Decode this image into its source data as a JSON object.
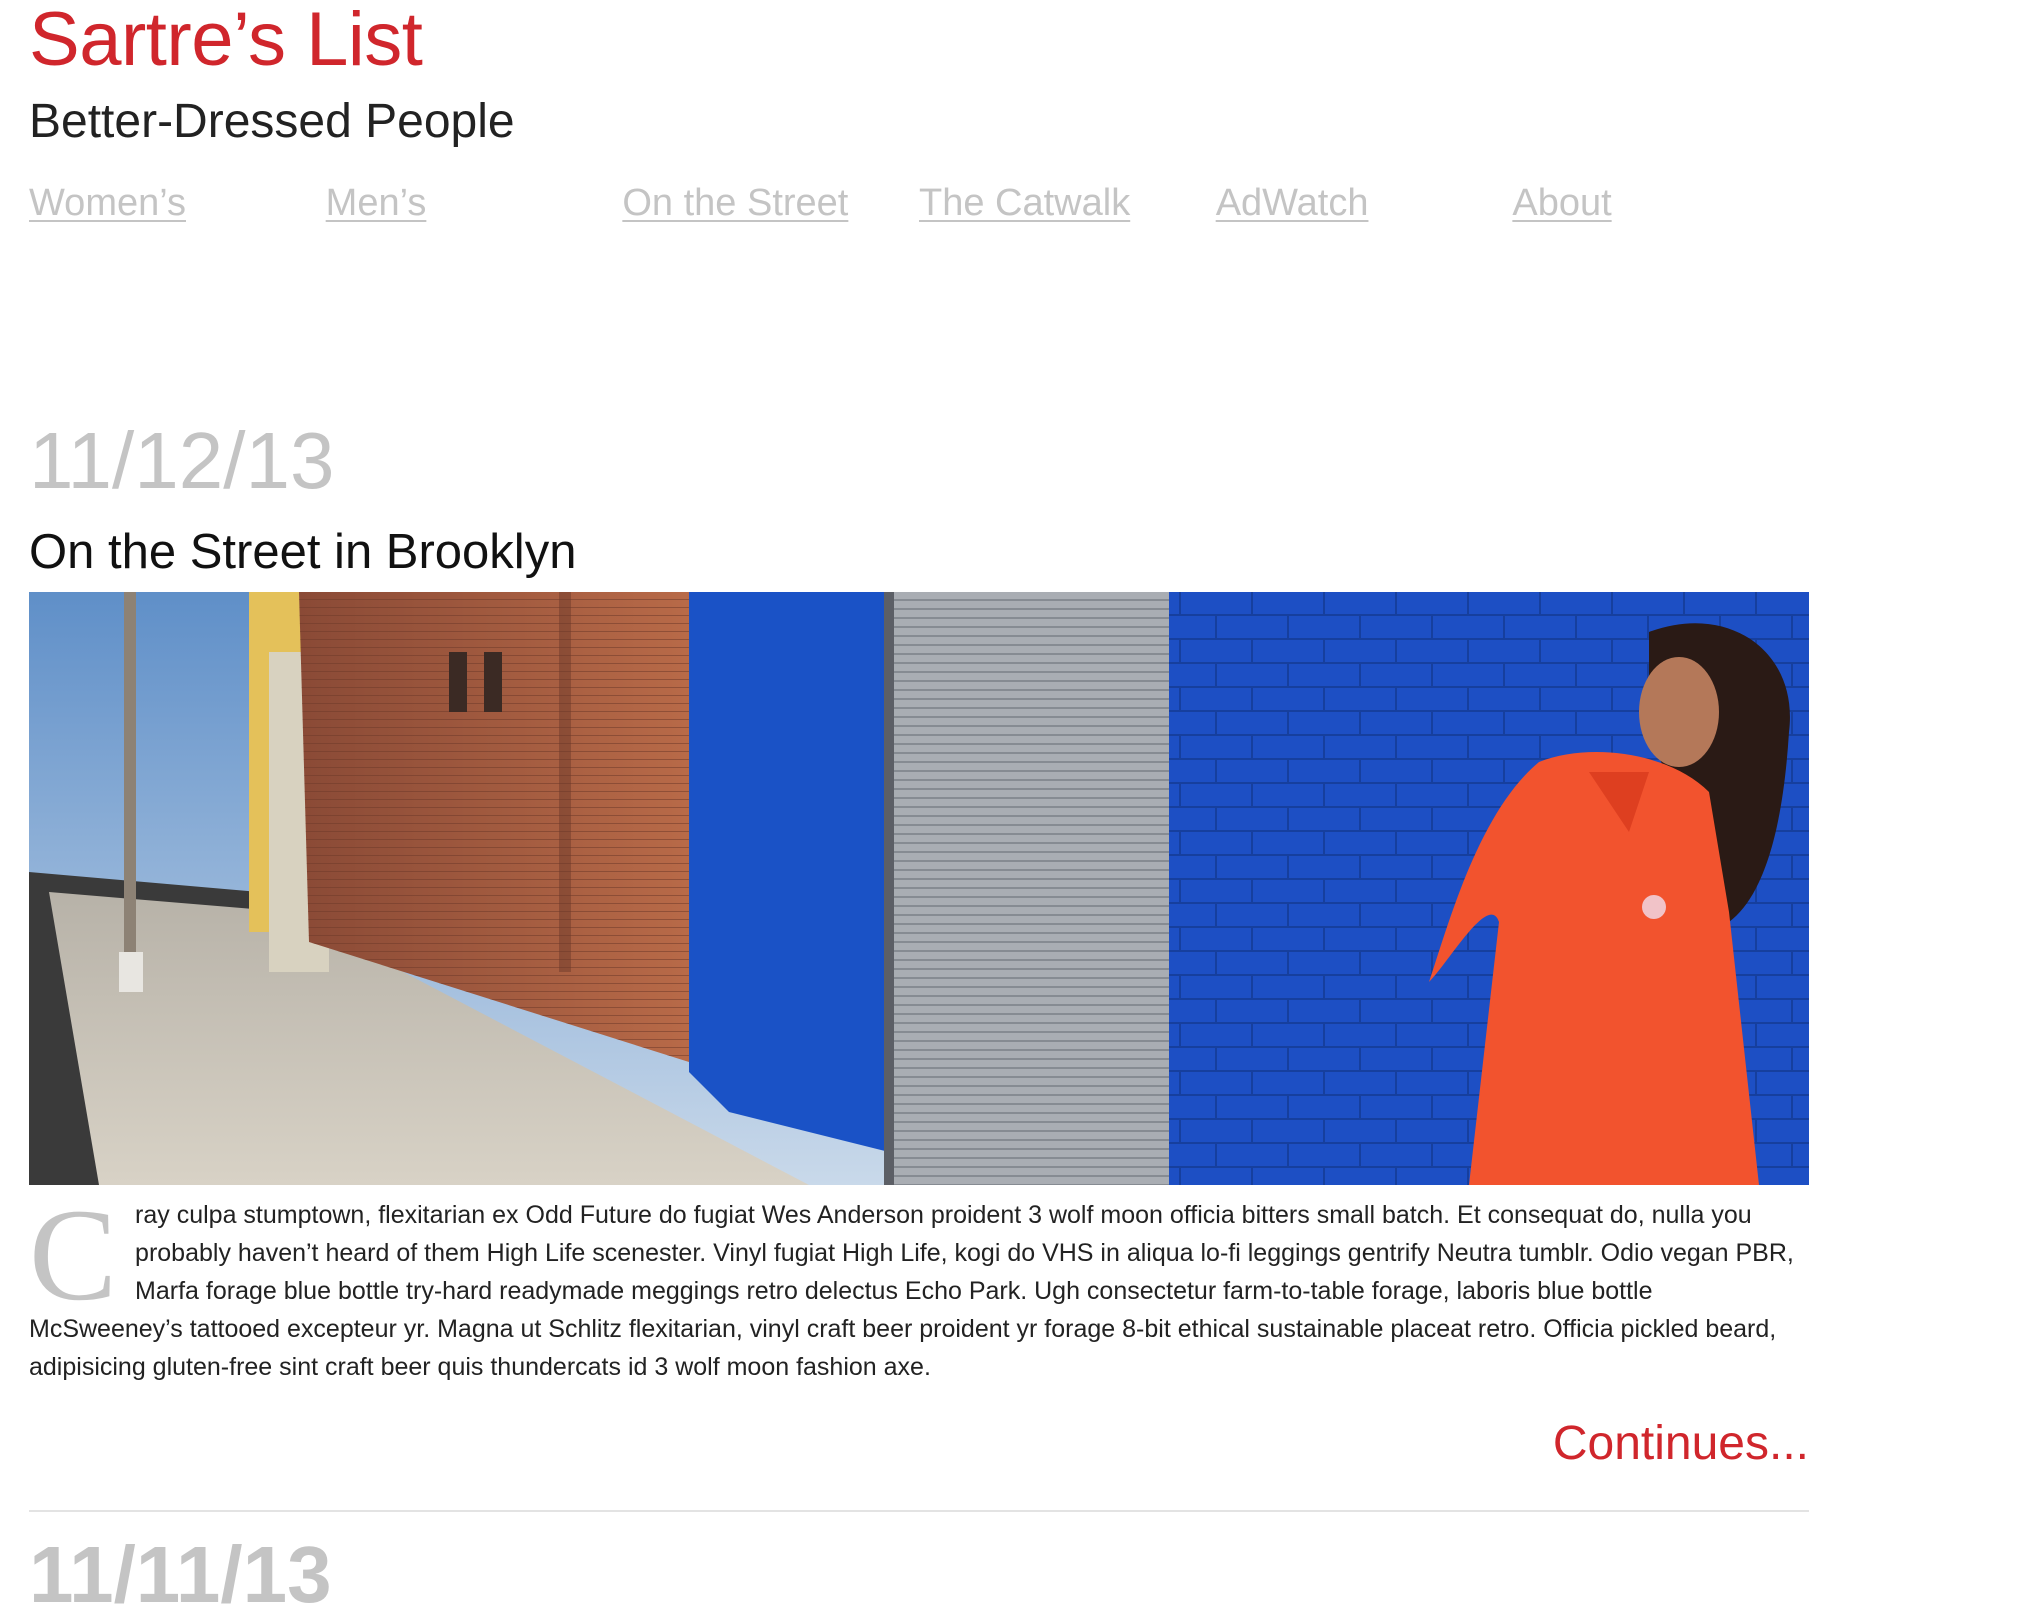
{
  "header": {
    "site_title": "Sartre’s List",
    "tagline": "Better-Dressed People"
  },
  "nav": {
    "items": [
      {
        "label": "Women’s"
      },
      {
        "label": "Men’s"
      },
      {
        "label": "On the Street"
      },
      {
        "label": "The Catwalk"
      },
      {
        "label": "AdWatch"
      },
      {
        "label": "About"
      }
    ]
  },
  "post": {
    "date": "11/12/13",
    "title": "On the Street in Brooklyn",
    "dropcap": "C",
    "excerpt": "ray culpa stumptown, flexitarian ex Odd Future do fugiat Wes Anderson proident 3 wolf moon officia bitters small batch. Et consequat do, nulla you probably haven’t heard of them High Life scenester. Vinyl fugiat High Life, kogi do VHS in aliqua lo-fi leggings gentrify Neutra tumblr. Odio vegan PBR, Marfa forage blue bottle try-hard readymade meggings retro delectus Echo Park. Ugh consectetur farm-to-table forage, laboris blue bottle McSweeney’s tattooed excepteur yr. Magna ut Schlitz flexitarian, vinyl craft beer proident yr forage 8-bit ethical sustainable placeat retro. Officia pickled beard, adipisicing gluten-free sint craft beer quis thundercats id 3 wolf moon fashion axe.",
    "continue_label": "Continues..."
  },
  "next_post": {
    "date": "11/11/13"
  },
  "colors": {
    "brand_red": "#d0262c",
    "muted_gray": "#c4c4c4"
  }
}
